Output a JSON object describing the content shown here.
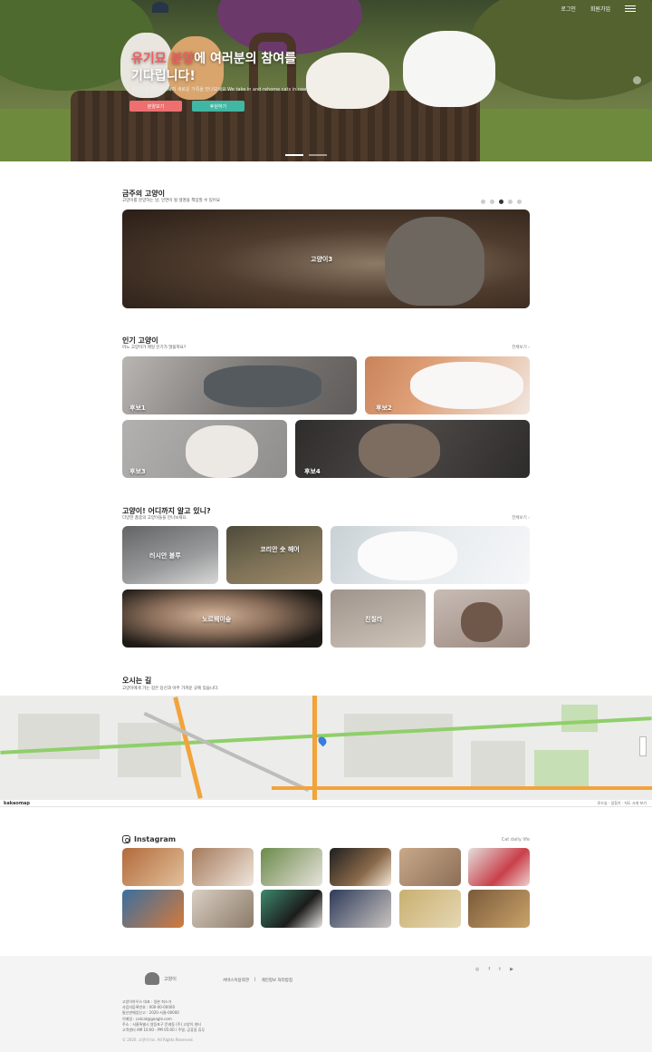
{
  "header": {
    "nav": [
      "로그인",
      "회원가입"
    ],
    "menu_icon": "hamburger-icon",
    "logo_icon": "cat-logo-icon"
  },
  "hero": {
    "title_highlight": "유기묘 분양",
    "title_rest": "에 여러분의 참여를",
    "title_line2": "기다립니다!",
    "subtitle": "유기묘 분양에 참여하여 새로운 가족을 만나보세요 We take in and rehome cats in need",
    "btn_primary": "분양보기",
    "btn_secondary": "후원하기"
  },
  "featured": {
    "title": "금주의 고양이",
    "subtitle": "고양이를 분양하는 날, 인연이 될 생명을 책임질 수 있어요",
    "card_label": "고양이3",
    "slide_count": 5,
    "active_slide": 3
  },
  "popular": {
    "title": "인기 고양이",
    "subtitle": "어느 고양이가 제일 인기가 많을까요?",
    "more": "전체보기 ›",
    "items": [
      "후보1",
      "후보2",
      "후보3",
      "후보4"
    ]
  },
  "breeds": {
    "title": "고양이! 어디까지 알고 있니?",
    "subtitle": "다양한 품종의 고양이들을 만나보세요.",
    "more": "전체보기 ›",
    "items": [
      "러시안 블루",
      "코리안 숏 헤어",
      "",
      "노르웨이숲",
      "친칠라",
      ""
    ]
  },
  "location": {
    "title": "오시는 길",
    "subtitle": "고양이에게 가는 길은 당신과 아주 가까운 곳에 있습니다.",
    "map_brand": "kakaomap",
    "map_links": "로드뷰 · 길찾기 · 지도 크게 보기"
  },
  "instagram": {
    "title": "Instagram",
    "tag": "Cat daily life",
    "thumb_count": 12
  },
  "footer": {
    "logo_text": "고양이",
    "links": [
      "서비스이용약관",
      "|",
      "개인정보 처리방침"
    ],
    "social": [
      "instagram-icon",
      "facebook-icon",
      "twitter-icon",
      "youtube-icon"
    ],
    "info": [
      "고양이하우스 대표 : 일본 퍼스가",
      "사업자등록번호 : 000-00-00000",
      "통신판매업신고 : 2020-서울-00000",
      "이메일 : catcat@google.com",
      "주소 : 서울특별시 영등포구 문래동 (주) 고양이 센터",
      "고객센터 AM 10:00 - PM 05:00 / 주말, 공휴일 휴무"
    ],
    "copyright": "© 2020. 고양이 Inc. All Rights Reserved."
  }
}
